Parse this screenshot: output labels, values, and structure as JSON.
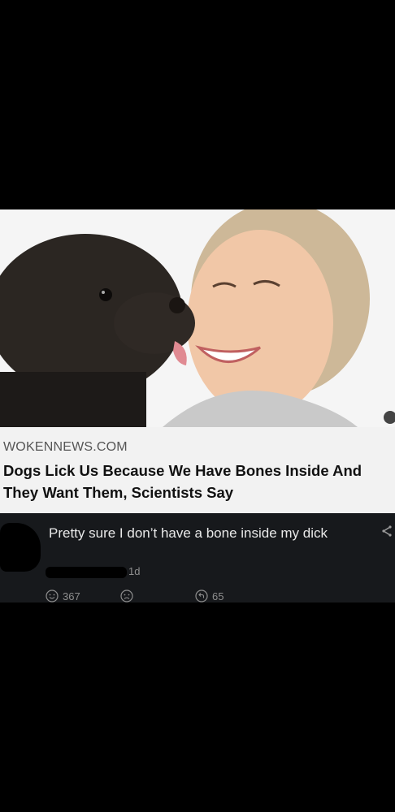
{
  "article": {
    "source": "WOKENNEWS.COM",
    "headline": "Dogs Lick Us Because We Have Bones Inside And They Want Them, Scientists Say",
    "image_icon": "woman-licked-by-dog-photo"
  },
  "comment": {
    "text": "Pretty sure I don’t have a bone inside my dick",
    "time": "1d",
    "share_icon": "share-icon",
    "reactions": [
      {
        "icon": "smile-icon",
        "count": "367"
      },
      {
        "icon": "sad-icon",
        "count": ""
      },
      {
        "icon": "reply-icon",
        "count": "65"
      }
    ]
  }
}
